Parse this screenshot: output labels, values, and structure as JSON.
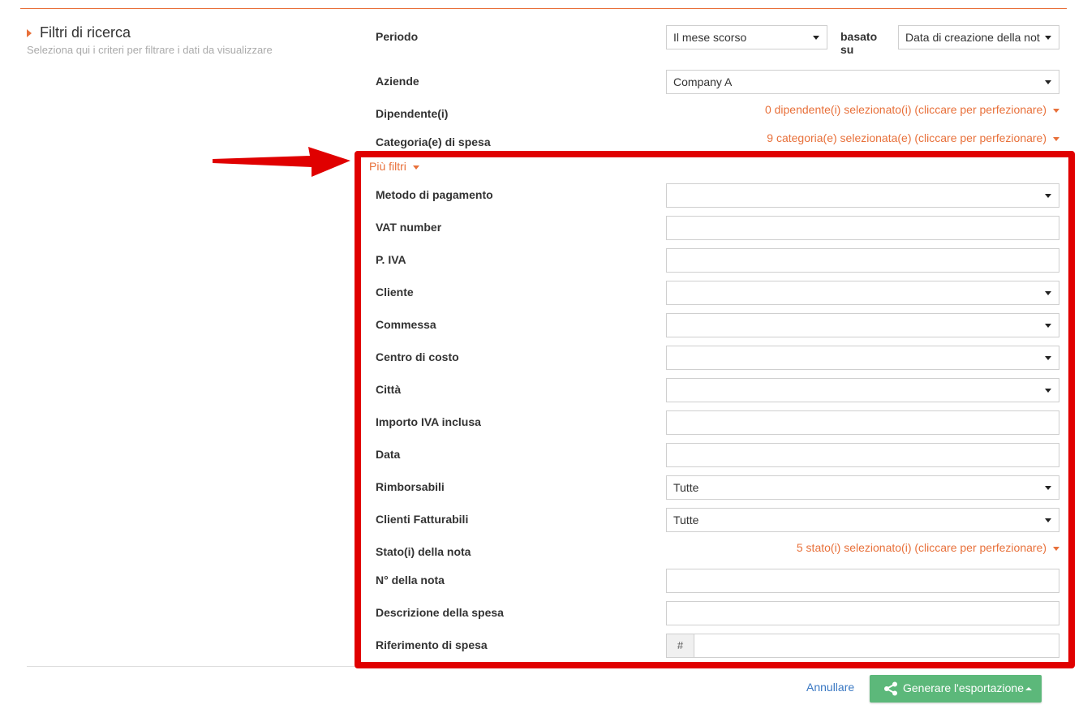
{
  "section": {
    "title": "Filtri di ricerca",
    "subtitle": "Seleziona qui i criteri per filtrare i dati da visualizzare"
  },
  "filters": {
    "periodo": {
      "label": "Periodo",
      "value": "Il mese scorso"
    },
    "basato_su": {
      "label_line1": "basato",
      "label_line2": "su",
      "value": "Data di creazione della not"
    },
    "aziende": {
      "label": "Aziende",
      "value": "Company A"
    },
    "dipendenti": {
      "label": "Dipendente(i)",
      "link": "0 dipendente(i) selezionato(i) (cliccare per perfezionare)"
    },
    "categorie": {
      "label": "Categoria(e) di spesa",
      "link": "9 categoria(e) selezionata(e) (cliccare per perfezionare)"
    }
  },
  "more_filters": {
    "toggle_label": "Più filtri",
    "metodo_pagamento": {
      "label": "Metodo di pagamento",
      "value": ""
    },
    "vat_number": {
      "label": "VAT number",
      "value": ""
    },
    "p_iva": {
      "label": "P. IVA",
      "value": ""
    },
    "cliente": {
      "label": "Cliente",
      "value": ""
    },
    "commessa": {
      "label": "Commessa",
      "value": ""
    },
    "centro_costo": {
      "label": "Centro di costo",
      "value": ""
    },
    "citta": {
      "label": "Città",
      "value": ""
    },
    "importo": {
      "label": "Importo IVA inclusa",
      "value": ""
    },
    "data": {
      "label": "Data",
      "value": ""
    },
    "rimborsabili": {
      "label": "Rimborsabili",
      "value": "Tutte"
    },
    "clienti_fatturabili": {
      "label": "Clienti Fatturabili",
      "value": "Tutte"
    },
    "stati": {
      "label": "Stato(i) della nota",
      "link": "5 stato(i) selezionato(i) (cliccare per perfezionare)"
    },
    "n_nota": {
      "label": "N° della nota",
      "value": ""
    },
    "descrizione": {
      "label": "Descrizione della spesa",
      "value": ""
    },
    "riferimento": {
      "label": "Riferimento di spesa",
      "addon": "#",
      "value": ""
    }
  },
  "actions": {
    "cancel": "Annullare",
    "export": "Generare l'esportazione"
  },
  "colors": {
    "accent": "#e8703a",
    "highlight_box": "#e00000",
    "export_button": "#5cb87a",
    "link": "#3a78c3"
  }
}
